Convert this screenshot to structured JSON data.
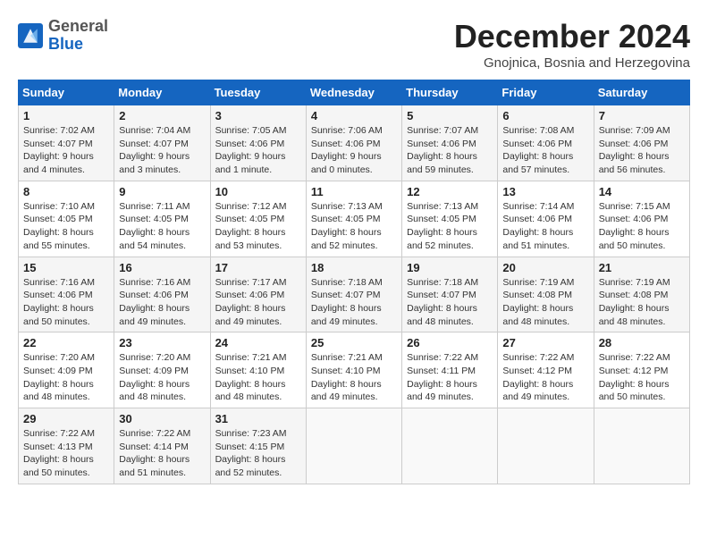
{
  "header": {
    "logo": {
      "general": "General",
      "blue": "Blue"
    },
    "title": "December 2024",
    "subtitle": "Gnojnica, Bosnia and Herzegovina"
  },
  "calendar": {
    "days": [
      "Sunday",
      "Monday",
      "Tuesday",
      "Wednesday",
      "Thursday",
      "Friday",
      "Saturday"
    ],
    "weeks": [
      [
        {
          "num": "1",
          "sunrise": "7:02 AM",
          "sunset": "4:07 PM",
          "daylight": "9 hours and 4 minutes."
        },
        {
          "num": "2",
          "sunrise": "7:04 AM",
          "sunset": "4:07 PM",
          "daylight": "9 hours and 3 minutes."
        },
        {
          "num": "3",
          "sunrise": "7:05 AM",
          "sunset": "4:06 PM",
          "daylight": "9 hours and 1 minute."
        },
        {
          "num": "4",
          "sunrise": "7:06 AM",
          "sunset": "4:06 PM",
          "daylight": "9 hours and 0 minutes."
        },
        {
          "num": "5",
          "sunrise": "7:07 AM",
          "sunset": "4:06 PM",
          "daylight": "8 hours and 59 minutes."
        },
        {
          "num": "6",
          "sunrise": "7:08 AM",
          "sunset": "4:06 PM",
          "daylight": "8 hours and 57 minutes."
        },
        {
          "num": "7",
          "sunrise": "7:09 AM",
          "sunset": "4:06 PM",
          "daylight": "8 hours and 56 minutes."
        }
      ],
      [
        {
          "num": "8",
          "sunrise": "7:10 AM",
          "sunset": "4:05 PM",
          "daylight": "8 hours and 55 minutes."
        },
        {
          "num": "9",
          "sunrise": "7:11 AM",
          "sunset": "4:05 PM",
          "daylight": "8 hours and 54 minutes."
        },
        {
          "num": "10",
          "sunrise": "7:12 AM",
          "sunset": "4:05 PM",
          "daylight": "8 hours and 53 minutes."
        },
        {
          "num": "11",
          "sunrise": "7:13 AM",
          "sunset": "4:05 PM",
          "daylight": "8 hours and 52 minutes."
        },
        {
          "num": "12",
          "sunrise": "7:13 AM",
          "sunset": "4:05 PM",
          "daylight": "8 hours and 52 minutes."
        },
        {
          "num": "13",
          "sunrise": "7:14 AM",
          "sunset": "4:06 PM",
          "daylight": "8 hours and 51 minutes."
        },
        {
          "num": "14",
          "sunrise": "7:15 AM",
          "sunset": "4:06 PM",
          "daylight": "8 hours and 50 minutes."
        }
      ],
      [
        {
          "num": "15",
          "sunrise": "7:16 AM",
          "sunset": "4:06 PM",
          "daylight": "8 hours and 50 minutes."
        },
        {
          "num": "16",
          "sunrise": "7:16 AM",
          "sunset": "4:06 PM",
          "daylight": "8 hours and 49 minutes."
        },
        {
          "num": "17",
          "sunrise": "7:17 AM",
          "sunset": "4:06 PM",
          "daylight": "8 hours and 49 minutes."
        },
        {
          "num": "18",
          "sunrise": "7:18 AM",
          "sunset": "4:07 PM",
          "daylight": "8 hours and 49 minutes."
        },
        {
          "num": "19",
          "sunrise": "7:18 AM",
          "sunset": "4:07 PM",
          "daylight": "8 hours and 48 minutes."
        },
        {
          "num": "20",
          "sunrise": "7:19 AM",
          "sunset": "4:08 PM",
          "daylight": "8 hours and 48 minutes."
        },
        {
          "num": "21",
          "sunrise": "7:19 AM",
          "sunset": "4:08 PM",
          "daylight": "8 hours and 48 minutes."
        }
      ],
      [
        {
          "num": "22",
          "sunrise": "7:20 AM",
          "sunset": "4:09 PM",
          "daylight": "8 hours and 48 minutes."
        },
        {
          "num": "23",
          "sunrise": "7:20 AM",
          "sunset": "4:09 PM",
          "daylight": "8 hours and 48 minutes."
        },
        {
          "num": "24",
          "sunrise": "7:21 AM",
          "sunset": "4:10 PM",
          "daylight": "8 hours and 48 minutes."
        },
        {
          "num": "25",
          "sunrise": "7:21 AM",
          "sunset": "4:10 PM",
          "daylight": "8 hours and 49 minutes."
        },
        {
          "num": "26",
          "sunrise": "7:22 AM",
          "sunset": "4:11 PM",
          "daylight": "8 hours and 49 minutes."
        },
        {
          "num": "27",
          "sunrise": "7:22 AM",
          "sunset": "4:12 PM",
          "daylight": "8 hours and 49 minutes."
        },
        {
          "num": "28",
          "sunrise": "7:22 AM",
          "sunset": "4:12 PM",
          "daylight": "8 hours and 50 minutes."
        }
      ],
      [
        {
          "num": "29",
          "sunrise": "7:22 AM",
          "sunset": "4:13 PM",
          "daylight": "8 hours and 50 minutes."
        },
        {
          "num": "30",
          "sunrise": "7:22 AM",
          "sunset": "4:14 PM",
          "daylight": "8 hours and 51 minutes."
        },
        {
          "num": "31",
          "sunrise": "7:23 AM",
          "sunset": "4:15 PM",
          "daylight": "8 hours and 52 minutes."
        },
        null,
        null,
        null,
        null
      ]
    ]
  }
}
